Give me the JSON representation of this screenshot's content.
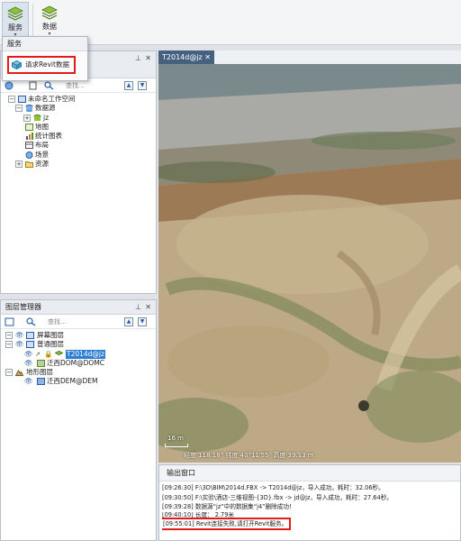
{
  "ribbon": {
    "service_label": "服务",
    "data_label": "数据"
  },
  "menu": {
    "header": "服务",
    "item_label": "请求Revit数据"
  },
  "workspace_panel": {
    "search_placeholder": "查找...",
    "tree": [
      {
        "label": "未命名工作空间",
        "level": 0,
        "expander": "-"
      },
      {
        "label": "数据源",
        "level": 1,
        "expander": "-"
      },
      {
        "label": "jz",
        "level": 2,
        "expander": "+"
      },
      {
        "label": "地图",
        "level": 1,
        "expander": ""
      },
      {
        "label": "统计图表",
        "level": 1,
        "expander": ""
      },
      {
        "label": "布局",
        "level": 1,
        "expander": ""
      },
      {
        "label": "场景",
        "level": 1,
        "expander": ""
      },
      {
        "label": "资源",
        "level": 1,
        "expander": "+"
      }
    ]
  },
  "layer_panel": {
    "title": "图层管理器",
    "search_placeholder": "查找...",
    "tree": [
      {
        "label": "屏幕图层",
        "level": 0
      },
      {
        "label": "普通图层",
        "level": 0
      },
      {
        "label": "T2014d@jz",
        "level": 1,
        "selected": true
      },
      {
        "label": "迁西DOM@DOMC",
        "level": 1
      },
      {
        "label": "地形图层",
        "level": 0
      },
      {
        "label": "迁西DEM@DEM",
        "level": 1
      }
    ]
  },
  "map": {
    "tab_label": "T2014d@jz",
    "scale_label": "16 m",
    "status_text": "经度 118.18°  纬度 40°11′55″    高度 39.13 m"
  },
  "output": {
    "title": "输出窗口",
    "lines": [
      "[09:26:30] F:\\3D\\BIM\\2014d.FBX   -> T2014d@jz，导入成功，耗时：32.06秒。",
      "[09:30:50] F:\\实验\\酒店-三维视图-{3D}.fbx      -> jd@jz，导入成功，耗时：27.64秒。",
      "[09:39:28] 数据源“jz”中的数据集“j4”删除成功!",
      "[09:40:10] 长度： 2.79米",
      "[09:55:01] Revit连接失败,请打开Revit服务。"
    ]
  },
  "colors": {
    "highlight": "#e21b1b",
    "selection": "#2d7fd4",
    "tab_active": "#46617f"
  }
}
